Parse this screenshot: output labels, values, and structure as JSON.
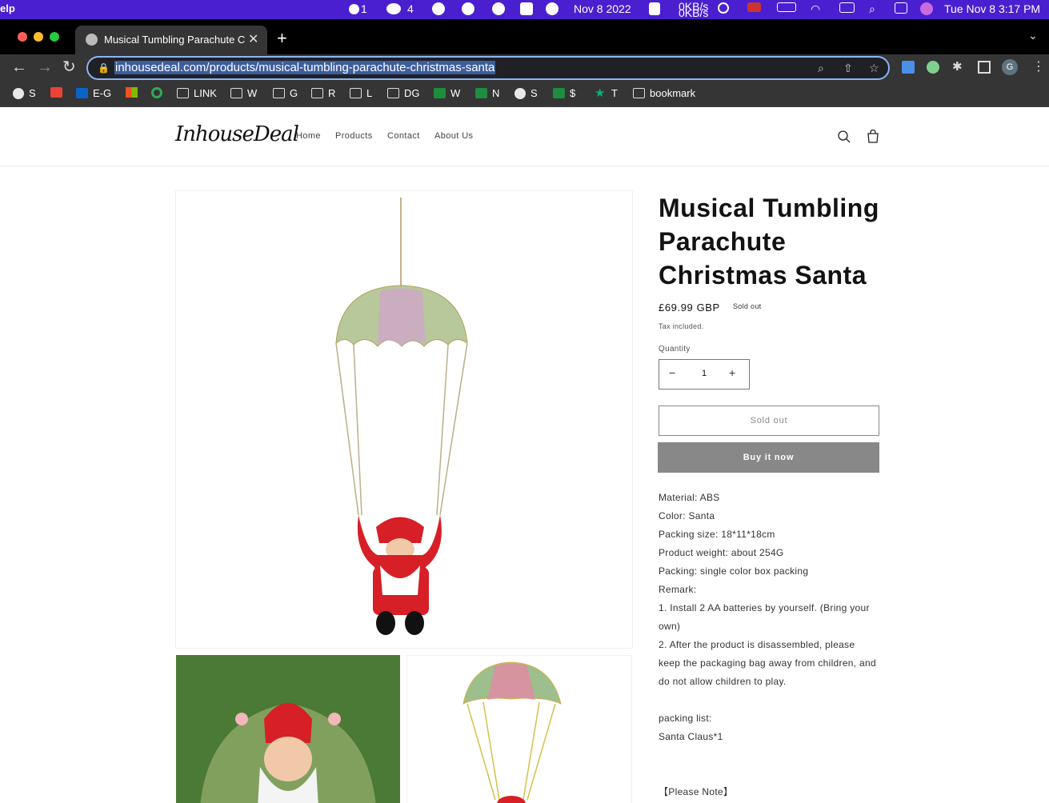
{
  "menubar": {
    "app_menu": "elp",
    "notif_count": "1",
    "chat_count": "4",
    "date_short": "Nov 8 2022",
    "net_up": "0KB/s",
    "net_down": "0KB/s",
    "datetime": "Tue Nov 8  3:17 PM"
  },
  "browser": {
    "tab_title": "Musical Tumbling Parachute Christmas Santa",
    "url": "inhousedeal.com/products/musical-tumbling-parachute-christmas-santa",
    "profile_initial": "G",
    "bookmarks": [
      {
        "icon": "globe-icon",
        "label": "S"
      },
      {
        "icon": "gmail-icon",
        "label": ""
      },
      {
        "icon": "outlook-icon",
        "label": "E-G"
      },
      {
        "icon": "microsoft-icon",
        "label": ""
      },
      {
        "icon": "google-icon",
        "label": ""
      },
      {
        "icon": "folder-icon",
        "label": "LINK"
      },
      {
        "icon": "folder-icon",
        "label": "W"
      },
      {
        "icon": "folder-icon",
        "label": "G"
      },
      {
        "icon": "folder-icon",
        "label": "R"
      },
      {
        "icon": "folder-icon",
        "label": "L"
      },
      {
        "icon": "folder-icon",
        "label": "DG"
      },
      {
        "icon": "sheets-icon",
        "label": "W"
      },
      {
        "icon": "sheets-icon",
        "label": "N"
      },
      {
        "icon": "globe-icon",
        "label": "S"
      },
      {
        "icon": "sheets-icon",
        "label": "$"
      },
      {
        "icon": "star-icon",
        "label": "T"
      },
      {
        "icon": "folder-icon",
        "label": "bookmark"
      }
    ]
  },
  "site": {
    "logo": "InhouseDeal",
    "nav": [
      "Home",
      "Products",
      "Contact",
      "About Us"
    ]
  },
  "product": {
    "title": "Musical Tumbling Parachute Christmas Santa",
    "price": "£69.99 GBP",
    "badge": "Sold out",
    "tax_note": "Tax included.",
    "quantity_label": "Quantity",
    "quantity": "1",
    "sold_out_button": "Sold out",
    "buy_now_button": "Buy it now",
    "description": [
      "Material: ABS",
      "Color: Santa",
      "Packing size: 18*11*18cm",
      "Product weight: about 254G",
      "Packing: single color box packing",
      "Remark:",
      "1. Install 2 AA batteries by yourself. (Bring your own)",
      "2. After the product is disassembled, please keep the packaging bag away from children, and do not allow children to play.",
      "",
      "packing list:",
      "Santa Claus*1",
      "",
      "",
      "【Please Note】"
    ]
  },
  "colors": {
    "menubar_bg": "#4a1fd0",
    "chrome_bg": "#353535",
    "buy_button_bg": "#888888"
  }
}
